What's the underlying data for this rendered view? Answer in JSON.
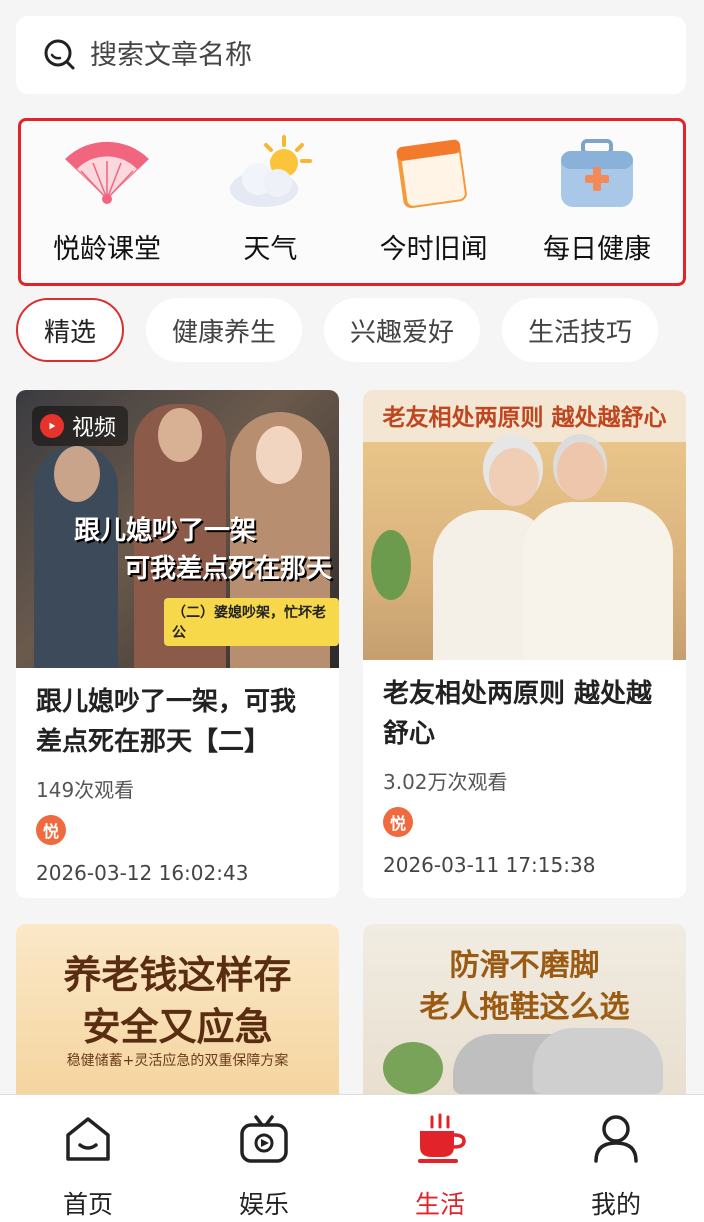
{
  "search": {
    "placeholder": "搜索文章名称"
  },
  "quick_links": [
    {
      "label": "悦龄课堂",
      "icon": "fan-icon"
    },
    {
      "label": "天气",
      "icon": "weather-icon"
    },
    {
      "label": "今时旧闻",
      "icon": "calendar-icon"
    },
    {
      "label": "每日健康",
      "icon": "medical-kit-icon"
    }
  ],
  "tabs": [
    {
      "label": "精选",
      "active": true
    },
    {
      "label": "健康养生",
      "active": false
    },
    {
      "label": "兴趣爱好",
      "active": false
    },
    {
      "label": "生活技巧",
      "active": false
    }
  ],
  "cards": [
    {
      "badge": "视频",
      "thumb_text": [
        "跟儿媳吵了一架",
        "可我差点死在那天",
        "（二）婆媳吵架，忙坏老公"
      ],
      "title": "跟儿媳吵了一架，可我差点死在那天【二】",
      "views": "149次观看",
      "time": "2026-03-12 16:02:43"
    },
    {
      "thumb_text": [
        "老友相处两原则 越处越舒心"
      ],
      "title": "老友相处两原则 越处越舒心",
      "views": "3.02万次观看",
      "time": "2026-03-11 17:15:38"
    },
    {
      "thumb_text": [
        "养老钱这样存",
        "安全又应急",
        "稳健储蓄+灵活应急的双重保障方案"
      ]
    },
    {
      "thumb_text": [
        "防滑不磨脚",
        "老人拖鞋这么选"
      ]
    }
  ],
  "bottom_nav": [
    {
      "label": "首页",
      "icon": "home-icon",
      "active": false
    },
    {
      "label": "娱乐",
      "icon": "tv-icon",
      "active": false
    },
    {
      "label": "生活",
      "icon": "cup-icon",
      "active": true
    },
    {
      "label": "我的",
      "icon": "user-icon",
      "active": false
    }
  ],
  "colors": {
    "accent": "#e3232a",
    "background": "#f5f5f5"
  }
}
